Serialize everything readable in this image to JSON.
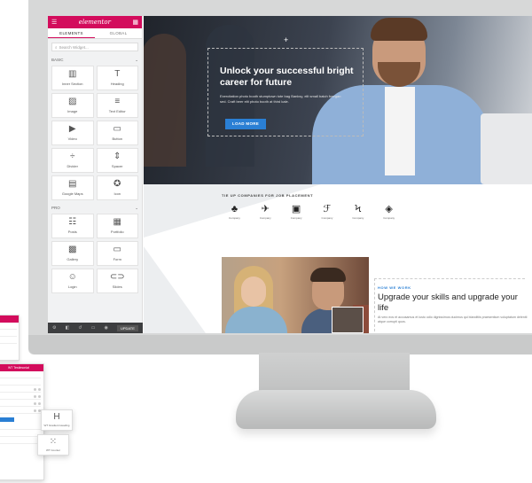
{
  "panel": {
    "logo": "elementor",
    "tabs": [
      "ELEMENTS",
      "GLOBAL"
    ],
    "search_placeholder": "Search Widget...",
    "sections": [
      "BASIC",
      "PRO"
    ],
    "basic_widgets": [
      {
        "label": "Inner Section",
        "icon": "columns-icon"
      },
      {
        "label": "Heading",
        "icon": "heading-icon"
      },
      {
        "label": "Image",
        "icon": "image-icon"
      },
      {
        "label": "Text Editor",
        "icon": "text-editor-icon"
      },
      {
        "label": "Video",
        "icon": "video-icon"
      },
      {
        "label": "Button",
        "icon": "button-icon"
      },
      {
        "label": "Divider",
        "icon": "divider-icon"
      },
      {
        "label": "Spacer",
        "icon": "spacer-icon"
      },
      {
        "label": "Google Maps",
        "icon": "map-icon"
      },
      {
        "label": "Icon",
        "icon": "star-icon"
      }
    ],
    "pro_widgets": [
      {
        "label": "Posts",
        "icon": "posts-icon"
      },
      {
        "label": "Portfolio",
        "icon": "portfolio-icon"
      },
      {
        "label": "Gallery",
        "icon": "gallery-icon"
      },
      {
        "label": "Form",
        "icon": "form-icon"
      },
      {
        "label": "Login",
        "icon": "login-icon"
      },
      {
        "label": "Slides",
        "icon": "slides-icon"
      }
    ],
    "update_label": "UPDATE"
  },
  "hero": {
    "title": "Unlock your successful bright career for future",
    "text": "Exercitation photo booth stumptown tote bag Banksy, elit small batch freegan sed. Craft beer elit photo booth at third kale.",
    "button": "LOAD MORE"
  },
  "partners": {
    "title": "TIE UP COMPANIES FOR JOB PLACEMENT",
    "logos": [
      {
        "glyph": "♣",
        "name": "Company"
      },
      {
        "glyph": "✈",
        "name": "Company"
      },
      {
        "glyph": "▣",
        "name": "Company"
      },
      {
        "glyph": "ℱ",
        "name": "Company"
      },
      {
        "glyph": "Ϟ",
        "name": "Company"
      },
      {
        "glyph": "◈",
        "name": "Company"
      }
    ]
  },
  "lower": {
    "eyebrow": "HOW WE WORK",
    "title": "Upgrade your skills and upgrade your life",
    "text": "At vero eos et accusamus et iusto odio dignissimos ducimus qui blanditiis praesentium voluptatum deleniti atque corrupti quos."
  },
  "floating": {
    "mini_title": "WT Testimonial",
    "card1": "WT Gradient Heading",
    "card2": "WT Counter"
  },
  "colors": {
    "brand": "#d30c5c",
    "accent": "#2a7fd4"
  }
}
